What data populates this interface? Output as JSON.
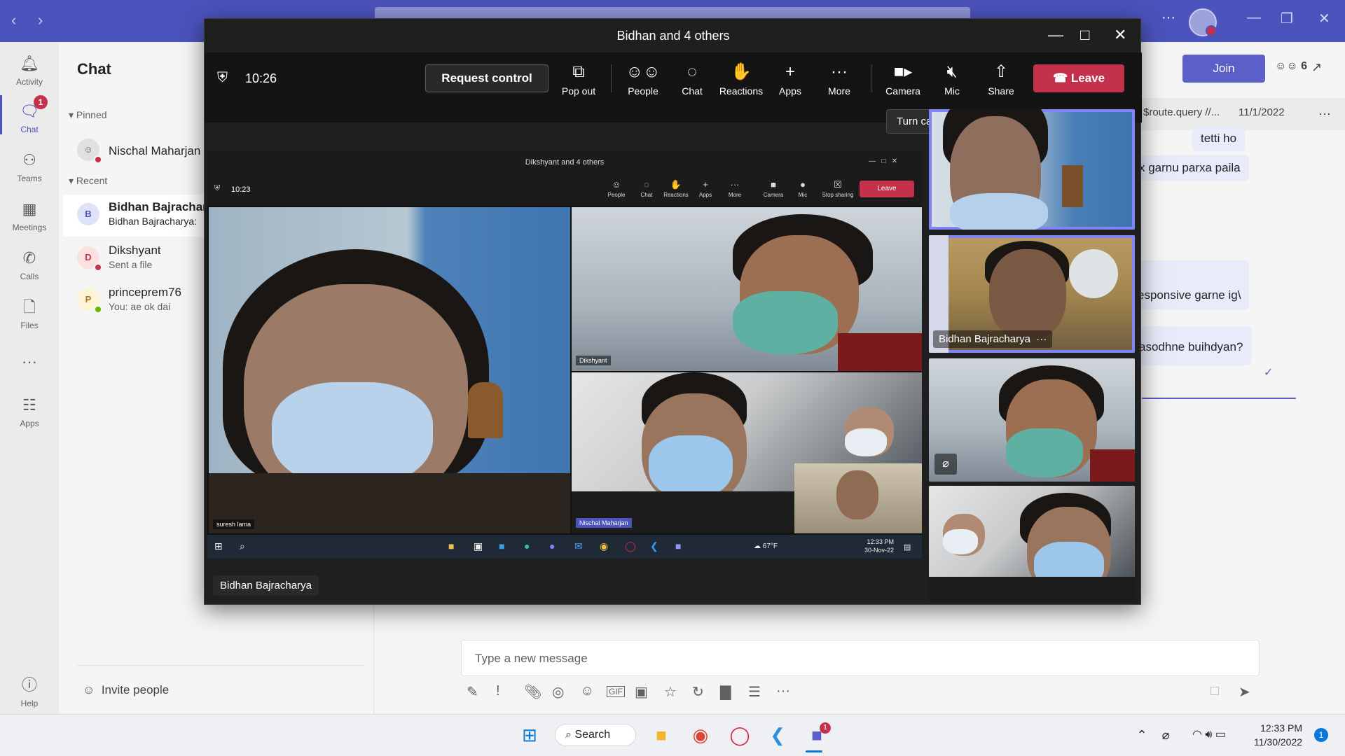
{
  "app": {
    "meeting_title": "Bidhan and 4 others",
    "people_count": "6",
    "join_label": "Join"
  },
  "rail": {
    "items": [
      {
        "label": "Activity",
        "icon": "bell-icon"
      },
      {
        "label": "Chat",
        "icon": "chat-icon",
        "badge": "1"
      },
      {
        "label": "Teams",
        "icon": "teams-icon"
      },
      {
        "label": "Meetings",
        "icon": "calendar-icon"
      },
      {
        "label": "Calls",
        "icon": "phone-icon"
      },
      {
        "label": "Files",
        "icon": "file-icon"
      },
      {
        "label": "Apps",
        "icon": "apps-icon"
      },
      {
        "label": "Help",
        "icon": "help-icon"
      }
    ],
    "more": "···"
  },
  "chatlist": {
    "title": "Chat",
    "pinned_label": "Pinned",
    "recent_label": "Recent",
    "pinned": [
      {
        "name": "Nischal Maharjan"
      }
    ],
    "recent": [
      {
        "name": "Bidhan Bajrachar",
        "preview": "Bidhan Bajracharya:",
        "initials": "B"
      },
      {
        "name": "Dikshyant",
        "preview": "Sent a file",
        "initials": "D"
      },
      {
        "name": "princeprem76",
        "preview": "You: ae ok dai",
        "initials": "P"
      }
    ],
    "invite": "Invite people"
  },
  "conversation": {
    "strip_text": "$route.query //...",
    "strip_date": "11/1/2022",
    "messages": [
      "tetti ho",
      "x garnu parxa paila",
      "esponsive garne ig\\",
      "asodhne buihdyan?"
    ],
    "compose_placeholder": "Type a new message"
  },
  "meeting": {
    "time": "10:26",
    "request_control": "Request control",
    "buttons": [
      {
        "label": "Pop out",
        "icon": "pop-out-icon"
      },
      {
        "label": "People",
        "icon": "people-icon"
      },
      {
        "label": "Chat",
        "icon": "chat-icon"
      },
      {
        "label": "Reactions",
        "icon": "reactions-icon"
      },
      {
        "label": "Apps",
        "icon": "plus-icon"
      },
      {
        "label": "More",
        "icon": "more-icon"
      },
      {
        "label": "Camera",
        "icon": "camera-icon"
      },
      {
        "label": "Mic",
        "icon": "mic-off-icon"
      },
      {
        "label": "Share",
        "icon": "share-icon"
      }
    ],
    "leave": "Leave",
    "tooltip": "Turn camera off (Ctrl+Shift+O)",
    "presenter": "Bidhan Bajracharya",
    "tile_name": "Bidhan Bajracharya",
    "tile_more": "···"
  },
  "shared_screen": {
    "title": "Dikshyant and 4 others",
    "time": "10:23",
    "buttons": [
      "People",
      "Chat",
      "Reactions",
      "Apps",
      "More",
      "Camera",
      "Mic",
      "Stop sharing"
    ],
    "leave": "Leave",
    "labels": [
      "suresh lama",
      "Dikshyant",
      "Nischal Maharjan"
    ],
    "temp": "67°F",
    "clock_time": "12:33 PM",
    "clock_date": "30-Nov-22"
  },
  "taskbar": {
    "search": "Search",
    "time": "12:33 PM",
    "date": "11/30/2022",
    "notif": "1",
    "teams_badge": "1"
  },
  "colors": {
    "brand": "#4b53bc",
    "leave": "#c4314b",
    "highlight": "#7f85f5"
  }
}
